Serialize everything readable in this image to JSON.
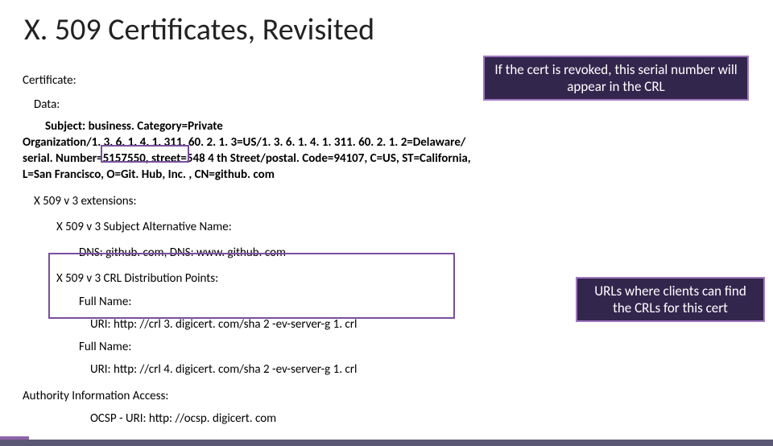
{
  "title": "X. 509 Certificates, Revisited",
  "cert_label": "Certificate:",
  "data_label": "Data:",
  "subject_lead": "Subject: business. Category=Private",
  "subject_rest": "Organization/1. 3. 6. 1. 4. 1. 311. 60. 2. 1. 3=US/1. 3. 6. 1. 4. 1. 311. 60. 2. 1. 2=Delaware/ serial. Number=5157550, street=548 4 th Street/postal. Code=94107, C=US, ST=California, L=San Francisco, O=Git. Hub, Inc. , CN=github. com",
  "ext_label": "X 509 v 3 extensions:",
  "san_label": "X 509 v 3 Subject Alternative Name:",
  "san_value": "DNS: github. com, DNS: www. github. com",
  "crl_label": "X 509 v 3 CRL Distribution Points:",
  "full1": "Full Name:",
  "uri1": "URI: http: //crl 3. digicert. com/sha 2 -ev-server-g 1. crl",
  "full2": "Full Name:",
  "uri2": "URI: http: //crl 4. digicert. com/sha 2 -ev-server-g 1. crl",
  "aia_label": "Authority Information Access:",
  "ocsp": "OCSP - URI: http: //ocsp. digicert. com",
  "callout1": "If the cert is revoked, this serial number will appear in the CRL",
  "callout2": "URLs where clients can find the CRLs for this cert"
}
